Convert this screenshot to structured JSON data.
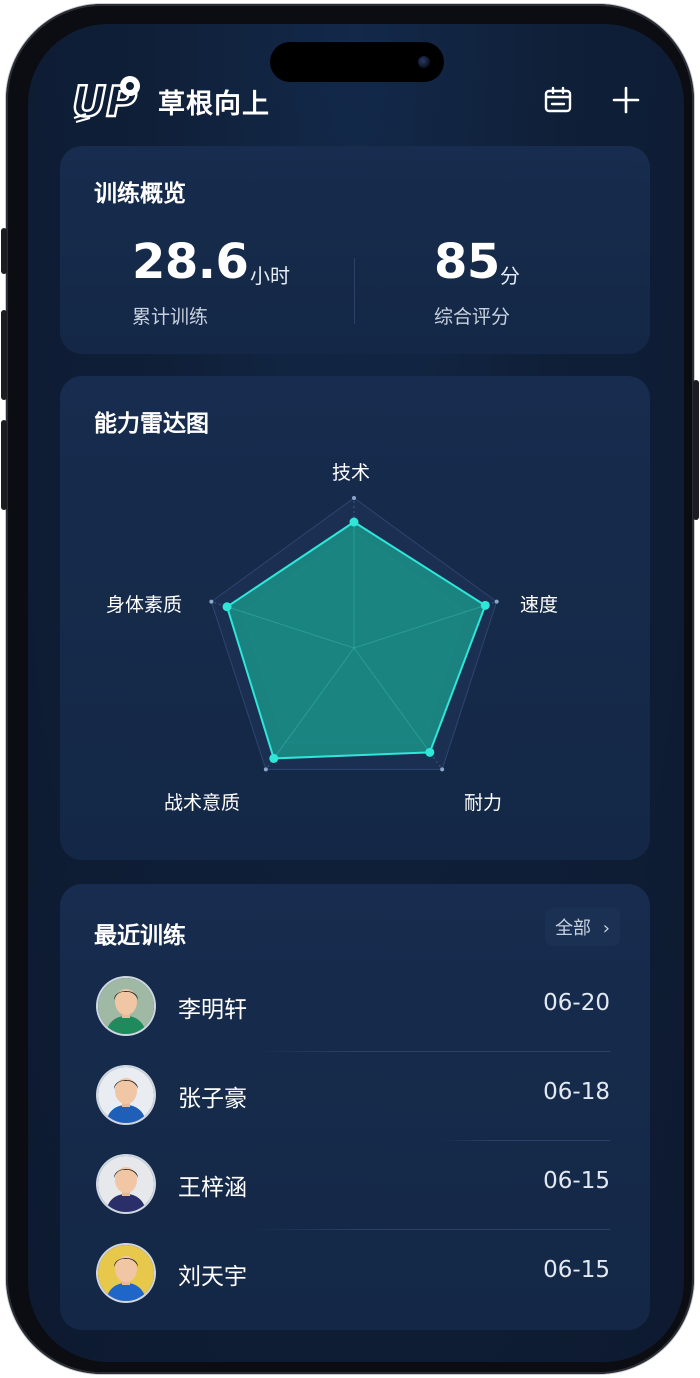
{
  "header": {
    "app_title": "草根向上",
    "logo_text": "UP"
  },
  "overview": {
    "title": "训练概览",
    "hours_value": "28.6",
    "hours_unit": "小时",
    "hours_label": "累计训练",
    "score_value": "85",
    "score_unit": "分",
    "score_label": "综合评分"
  },
  "radar": {
    "title": "能力雷达图",
    "axes": [
      "技术",
      "速度",
      "耐力",
      "战术意质",
      "身体素质"
    ],
    "values": [
      0.84,
      0.92,
      0.86,
      0.91,
      0.89
    ],
    "scale_max": 1,
    "fill_color": "#1a8f86",
    "stroke_color": "#2fe6d8"
  },
  "recent": {
    "title": "最近训练",
    "all_label": "全部",
    "items": [
      {
        "name": "李明轩",
        "date": "06-20",
        "jersey": "#1f8a5b",
        "bg": "#9fb9a4"
      },
      {
        "name": "张子豪",
        "date": "06-18",
        "jersey": "#1f5fb8",
        "bg": "#e9edf2"
      },
      {
        "name": "王梓涵",
        "date": "06-15",
        "jersey": "#2a2f6a",
        "bg": "#e6e8ec"
      },
      {
        "name": "刘天宇",
        "date": "06-15",
        "jersey": "#1f66c9",
        "bg": "#e8c84a"
      }
    ]
  },
  "colors": {
    "screen_bg": "#0e1d33",
    "card_bg": "#15294a",
    "accent": "#2fe6d8"
  },
  "icons": {
    "calendar": "calendar-icon",
    "add": "plus-icon",
    "chevron": "chevron-right-icon"
  }
}
